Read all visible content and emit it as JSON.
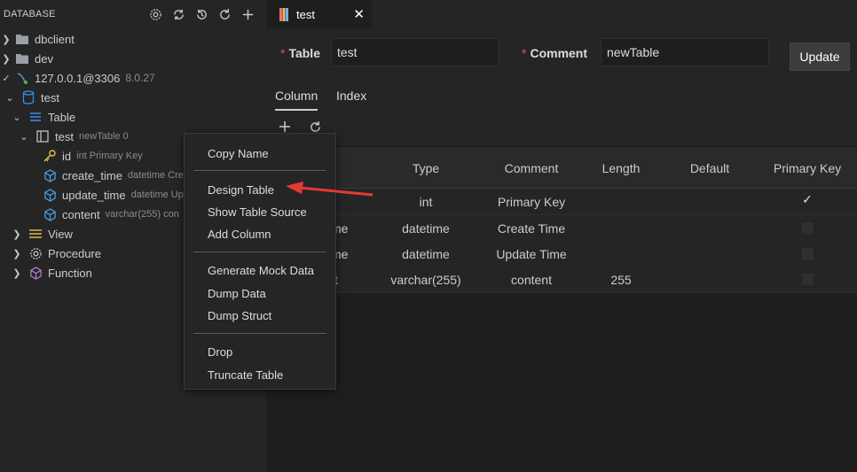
{
  "sidebar": {
    "title": "DATABASE",
    "actions": [
      "gear-icon",
      "sync-icon",
      "history-icon",
      "refresh-icon",
      "add-icon"
    ],
    "tree": [
      {
        "label": "dbclient",
        "icon": "folder-icon"
      },
      {
        "label": "dev",
        "icon": "folder-icon"
      },
      {
        "label": "127.0.0.1@3306",
        "desc": "8.0.27",
        "icon": "mysql-connection-icon"
      },
      {
        "label": "test",
        "icon": "database-icon"
      },
      {
        "label": "Table",
        "icon": "list-icon"
      },
      {
        "label": "test",
        "desc": "newTable 0",
        "icon": "table-icon"
      },
      {
        "label": "id",
        "desc": "int Primary Key",
        "icon": "key-icon"
      },
      {
        "label": "create_time",
        "desc": "datetime Cre",
        "icon": "column-icon"
      },
      {
        "label": "update_time",
        "desc": "datetime Up",
        "icon": "column-icon"
      },
      {
        "label": "content",
        "desc": "varchar(255) con",
        "icon": "column-icon"
      },
      {
        "label": "View",
        "icon": "view-icon"
      },
      {
        "label": "Procedure",
        "icon": "gear-icon"
      },
      {
        "label": "Function",
        "icon": "cube-icon"
      }
    ]
  },
  "editor": {
    "tab": {
      "label": "test",
      "close": "✕"
    },
    "form": {
      "table_label": "Table",
      "table_value": "test",
      "comment_label": "Comment",
      "comment_value": "newTable",
      "required_mark": "*",
      "update_button": "Update"
    },
    "subtabs": [
      "Column",
      "Index"
    ],
    "grid": {
      "headers": [
        "Type",
        "Comment",
        "Length",
        "Default",
        "Primary Key"
      ],
      "rows": [
        {
          "name": "",
          "type": "int",
          "comment": "Primary Key",
          "length": "",
          "primary": true
        },
        {
          "name": "me",
          "type": "datetime",
          "comment": "Create Time",
          "length": "",
          "primary": false
        },
        {
          "name": "me",
          "type": "datetime",
          "comment": "Update Time",
          "length": "",
          "primary": false
        },
        {
          "name": "t",
          "type": "varchar(255)",
          "comment": "content",
          "length": "255",
          "primary": false
        }
      ]
    }
  },
  "context_menu": {
    "items": [
      "Copy Name",
      "Design Table",
      "Show Table Source",
      "Add Column",
      "Generate Mock Data",
      "Dump Data",
      "Dump Struct",
      "Drop",
      "Truncate Table"
    ]
  }
}
